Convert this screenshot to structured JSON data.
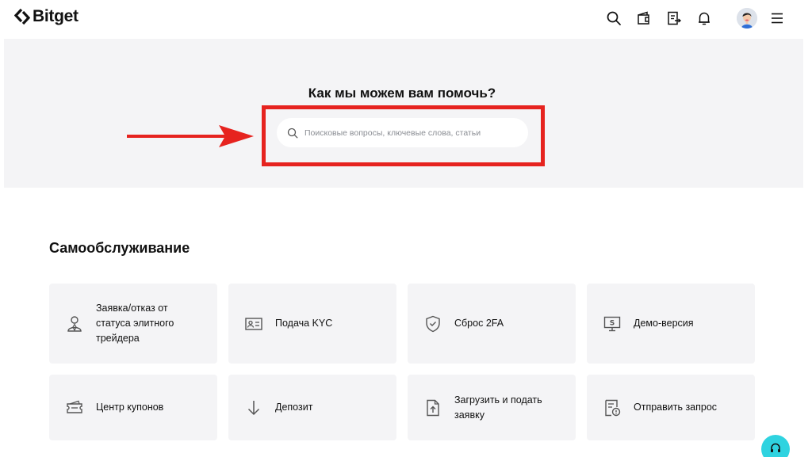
{
  "header": {
    "logo_text": "Bitget",
    "icons": [
      "search-icon",
      "wallet-icon",
      "orders-icon",
      "bell-icon",
      "avatar",
      "menu-icon"
    ]
  },
  "hero": {
    "title": "Как мы можем вам помочь?",
    "search_placeholder": "Поисковые вопросы, ключевые слова, статьи"
  },
  "self_service": {
    "title": "Самообслуживание",
    "cards": [
      {
        "label": "Заявка/отказ от статуса элитного трейдера",
        "icon": "elite-trader-icon"
      },
      {
        "label": "Подача KYC",
        "icon": "id-card-icon"
      },
      {
        "label": "Сброс 2FA",
        "icon": "shield-icon"
      },
      {
        "label": "Демо-версия",
        "icon": "demo-monitor-icon"
      },
      {
        "label": "Центр купонов",
        "icon": "coupon-icon"
      },
      {
        "label": "Депозит",
        "icon": "arrow-down-icon"
      },
      {
        "label": "Загрузить и подать заявку",
        "icon": "upload-file-icon"
      },
      {
        "label": "Отправить запрос",
        "icon": "request-icon"
      }
    ]
  },
  "colors": {
    "highlight": "#e6231f",
    "hero_bg": "#f4f4f6",
    "card_bg": "#f4f4f6",
    "support_button": "#2fd3e0"
  }
}
